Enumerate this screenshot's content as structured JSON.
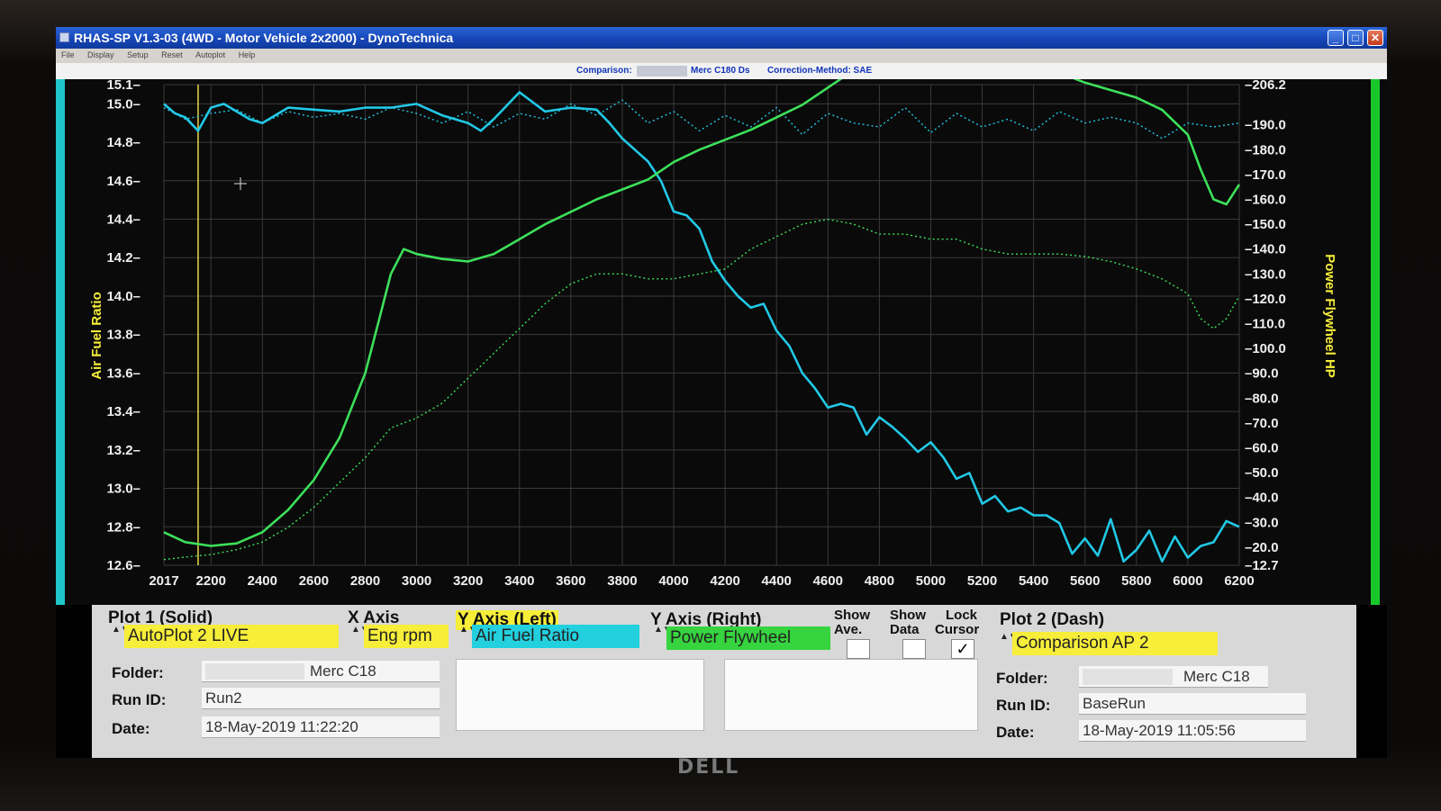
{
  "window": {
    "title": "RHAS-SP V1.3-03  (4WD - Motor Vehicle 2x2000) - DynoTechnica",
    "menu": [
      "File",
      "Display",
      "Setup",
      "Reset",
      "Autoplot",
      "Help"
    ],
    "buttons": {
      "minimize": "_",
      "maximize": "□",
      "close": "✕"
    }
  },
  "infobar": {
    "comparison_label": "Comparison:",
    "vehicle": "Merc C180 Ds",
    "correction": "Correction-Method: SAE"
  },
  "chart_data": {
    "type": "line",
    "xlabel": "",
    "ylabel": "Air Fuel Ratio",
    "ylabel_right": "Power Flywheel HP",
    "xlim": [
      2017,
      6200
    ],
    "ylim": [
      12.6,
      15.1
    ],
    "ylim_right": [
      12.7,
      206.2
    ],
    "x_ticks": [
      "2017",
      "2200",
      "2400",
      "2600",
      "2800",
      "3000",
      "3200",
      "3400",
      "3600",
      "3800",
      "4000",
      "4200",
      "4400",
      "4600",
      "4800",
      "5000",
      "5200",
      "5400",
      "5600",
      "5800",
      "6000",
      "6200"
    ],
    "y_ticks_left": [
      "15.1",
      "15.0",
      "14.8",
      "14.6",
      "14.4",
      "14.2",
      "14.0",
      "13.8",
      "13.6",
      "13.4",
      "13.2",
      "13.0",
      "12.8",
      "12.6"
    ],
    "y_ticks_right": [
      "206.2",
      "190.0",
      "180.0",
      "170.0",
      "160.0",
      "150.0",
      "140.0",
      "130.0",
      "120.0",
      "110.0",
      "100.0",
      "90.0",
      "80.0",
      "70.0",
      "60.0",
      "50.0",
      "40.0",
      "30.0",
      "20.0",
      "12.7"
    ],
    "grid": true,
    "cursor_rpm": 2150,
    "series": [
      {
        "axis": "left",
        "style": "solid",
        "color": "#22c8e6",
        "x": [
          2017,
          2060,
          2100,
          2150,
          2200,
          2250,
          2300,
          2350,
          2400,
          2500,
          2600,
          2700,
          2800,
          2900,
          3000,
          3100,
          3200,
          3250,
          3300,
          3400,
          3500,
          3600,
          3700,
          3750,
          3800,
          3900,
          3950,
          4000,
          4050,
          4100,
          4150,
          4200,
          4250,
          4300,
          4350,
          4400,
          4450,
          4500,
          4550,
          4600,
          4650,
          4700,
          4750,
          4800,
          4850,
          4900,
          4950,
          5000,
          5050,
          5100,
          5150,
          5200,
          5250,
          5300,
          5350,
          5400,
          5450,
          5500,
          5550,
          5600,
          5650,
          5700,
          5750,
          5800,
          5850,
          5900,
          5950,
          6000,
          6050,
          6100,
          6150,
          6200
        ],
        "y": [
          15.0,
          14.95,
          14.93,
          14.86,
          14.98,
          15.0,
          14.96,
          14.92,
          14.9,
          14.98,
          14.97,
          14.96,
          14.98,
          14.98,
          15.0,
          14.94,
          14.9,
          14.86,
          14.92,
          15.06,
          14.96,
          14.98,
          14.97,
          14.9,
          14.82,
          14.7,
          14.6,
          14.44,
          14.42,
          14.35,
          14.18,
          14.08,
          14.0,
          13.94,
          13.96,
          13.82,
          13.74,
          13.6,
          13.52,
          13.42,
          13.44,
          13.42,
          13.28,
          13.37,
          13.32,
          13.26,
          13.19,
          13.24,
          13.16,
          13.05,
          13.08,
          12.92,
          12.96,
          12.88,
          12.9,
          12.86,
          12.86,
          12.82,
          12.66,
          12.74,
          12.65,
          12.84,
          12.62,
          12.68,
          12.78,
          12.62,
          12.75,
          12.64,
          12.7,
          12.72,
          12.83,
          12.8
        ]
      },
      {
        "axis": "left",
        "style": "dash",
        "color": "#22c8e6",
        "x": [
          2017,
          2100,
          2200,
          2300,
          2400,
          2500,
          2600,
          2700,
          2800,
          2900,
          3000,
          3100,
          3200,
          3300,
          3400,
          3500,
          3600,
          3700,
          3800,
          3900,
          4000,
          4100,
          4200,
          4300,
          4400,
          4500,
          4600,
          4700,
          4800,
          4900,
          5000,
          5100,
          5200,
          5300,
          5400,
          5500,
          5600,
          5700,
          5800,
          5900,
          6000,
          6100,
          6200
        ],
        "y": [
          14.98,
          14.92,
          14.95,
          14.97,
          14.9,
          14.96,
          14.93,
          14.95,
          14.92,
          14.98,
          14.95,
          14.9,
          14.96,
          14.88,
          14.95,
          14.92,
          15.0,
          14.94,
          15.02,
          14.9,
          14.96,
          14.86,
          14.94,
          14.88,
          14.98,
          14.84,
          14.95,
          14.9,
          14.88,
          14.98,
          14.85,
          14.95,
          14.88,
          14.92,
          14.86,
          14.96,
          14.9,
          14.93,
          14.9,
          14.82,
          14.9,
          14.88,
          14.9
        ]
      },
      {
        "axis": "right",
        "style": "solid",
        "color": "#3de05a",
        "x": [
          2017,
          2100,
          2200,
          2300,
          2400,
          2500,
          2600,
          2700,
          2800,
          2850,
          2900,
          2950,
          3000,
          3100,
          3200,
          3300,
          3400,
          3500,
          3600,
          3700,
          3800,
          3900,
          4000,
          4100,
          4200,
          4300,
          4400,
          4500,
          4600,
          4700,
          4800,
          4900,
          5000,
          5100,
          5200,
          5300,
          5400,
          5500,
          5600,
          5700,
          5800,
          5900,
          6000,
          6050,
          6100,
          6150,
          6200
        ],
        "y": [
          26.0,
          22.0,
          20.5,
          21.5,
          26.0,
          35.0,
          47.0,
          64.0,
          90.0,
          110.0,
          130.0,
          140.0,
          138.0,
          136.0,
          135.0,
          138.0,
          144.0,
          150.0,
          155.0,
          160.0,
          164.0,
          168.0,
          175.0,
          180.0,
          184.0,
          188.0,
          193.0,
          198.0,
          205.0,
          212.0,
          220.0,
          226.0,
          229.0,
          231.0,
          229.0,
          224.0,
          217.0,
          211.0,
          207.0,
          204.0,
          201.0,
          196.0,
          186.0,
          172.0,
          160.0,
          158.0,
          166.0
        ]
      },
      {
        "axis": "right",
        "style": "dash",
        "color": "#3de05a",
        "x": [
          2017,
          2100,
          2200,
          2300,
          2400,
          2500,
          2600,
          2700,
          2800,
          2900,
          3000,
          3100,
          3200,
          3300,
          3400,
          3500,
          3600,
          3700,
          3800,
          3900,
          4000,
          4100,
          4200,
          4300,
          4400,
          4500,
          4600,
          4700,
          4800,
          4900,
          5000,
          5100,
          5200,
          5300,
          5400,
          5500,
          5600,
          5700,
          5800,
          5900,
          6000,
          6050,
          6100,
          6150,
          6200
        ],
        "y": [
          15.0,
          16.0,
          17.0,
          19.0,
          22.0,
          28.0,
          36.0,
          46.0,
          56.0,
          68.0,
          72.0,
          78.0,
          88.0,
          98.0,
          108.0,
          118.0,
          126.0,
          130.0,
          130.0,
          128.0,
          128.0,
          130.0,
          132.0,
          140.0,
          145.0,
          150.0,
          152.0,
          150.0,
          146.0,
          146.0,
          144.0,
          144.0,
          140.0,
          138.0,
          138.0,
          138.0,
          137.0,
          135.0,
          132.0,
          128.0,
          122.0,
          112.0,
          108.0,
          112.0,
          121.0
        ]
      }
    ]
  },
  "panel": {
    "plot1_label": "Plot 1 (Solid)",
    "xaxis_label": "X Axis",
    "yaxis_left_label": "Y Axis (Left)",
    "yaxis_right_label": "Y Axis (Right)",
    "show_ave_label_1": "Show",
    "show_ave_label_2": "Ave.",
    "show_data_label_1": "Show",
    "show_data_label_2": "Data",
    "lock_cursor_label_1": "Lock",
    "lock_cursor_label_2": "Cursor",
    "plot2_label": "Plot 2 (Dash)",
    "plot1_select": "AutoPlot 2 LIVE",
    "xaxis_select": "Eng rpm",
    "yaxis_left_select": "Air Fuel Ratio",
    "yaxis_right_select": "Power Flywheel",
    "plot2_select": "Comparison AP 2",
    "check_mark": "✓",
    "colors": {
      "plot_select": "#f7ee3a",
      "left_select": "#22d0de",
      "right_select": "#36d43e"
    },
    "spinner": "▲▼",
    "plot1": {
      "folder_label": "Folder:",
      "folder_value": "Merc C18",
      "runid_label": "Run ID:",
      "runid_value": "Run2",
      "date_label": "Date:",
      "date_value": "18-May-2019  11:22:20"
    },
    "plot2": {
      "folder_label": "Folder:",
      "folder_value": "Merc C18",
      "runid_label": "Run ID:",
      "runid_value": "BaseRun",
      "date_label": "Date:",
      "date_value": "18-May-2019  11:05:56"
    }
  },
  "monitor": {
    "brand": "DELL"
  }
}
